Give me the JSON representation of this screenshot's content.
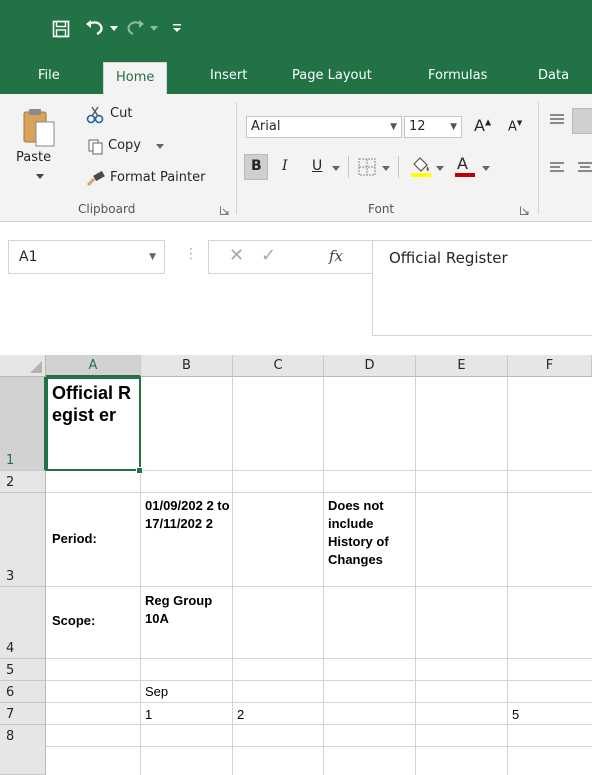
{
  "quick_access": {
    "save_icon": "save-icon",
    "undo_icon": "undo-icon",
    "redo_icon": "redo-icon",
    "customize_icon": "customize-qat-icon"
  },
  "ribbon_tabs": [
    "File",
    "Home",
    "Insert",
    "Page Layout",
    "Formulas",
    "Data"
  ],
  "active_tab": "Home",
  "clipboard": {
    "paste_label": "Paste",
    "cut_label": "Cut",
    "copy_label": "Copy",
    "format_painter_label": "Format Painter",
    "group_label": "Clipboard"
  },
  "font": {
    "font_name": "Arial",
    "font_size": "12",
    "bold": "B",
    "italic": "I",
    "underline": "U",
    "group_label": "Font"
  },
  "formula_bar": {
    "name_box": "A1",
    "fx": "fx",
    "content": "Official Register"
  },
  "columns": [
    "A",
    "B",
    "C",
    "D",
    "E",
    "F"
  ],
  "rows": [
    "1",
    "2",
    "3",
    "4",
    "5",
    "6",
    "7",
    "8"
  ],
  "cells": {
    "A1": "Official Regist er",
    "A3": "Period:",
    "B3": "01/09/202 2 to 17/11/202 2",
    "D3": "Does not include History of Changes",
    "A4": "Scope:",
    "B4": "Reg Group 10A",
    "B6": "Sep",
    "B7": "1",
    "C7": "2",
    "F7": "5"
  },
  "colors": {
    "excel_green": "#217346",
    "ribbon_bg": "#f3f3f3",
    "header_bg": "#e6e6e6",
    "font_color_red": "#c00000",
    "highlight_yellow": "#ffff00"
  }
}
